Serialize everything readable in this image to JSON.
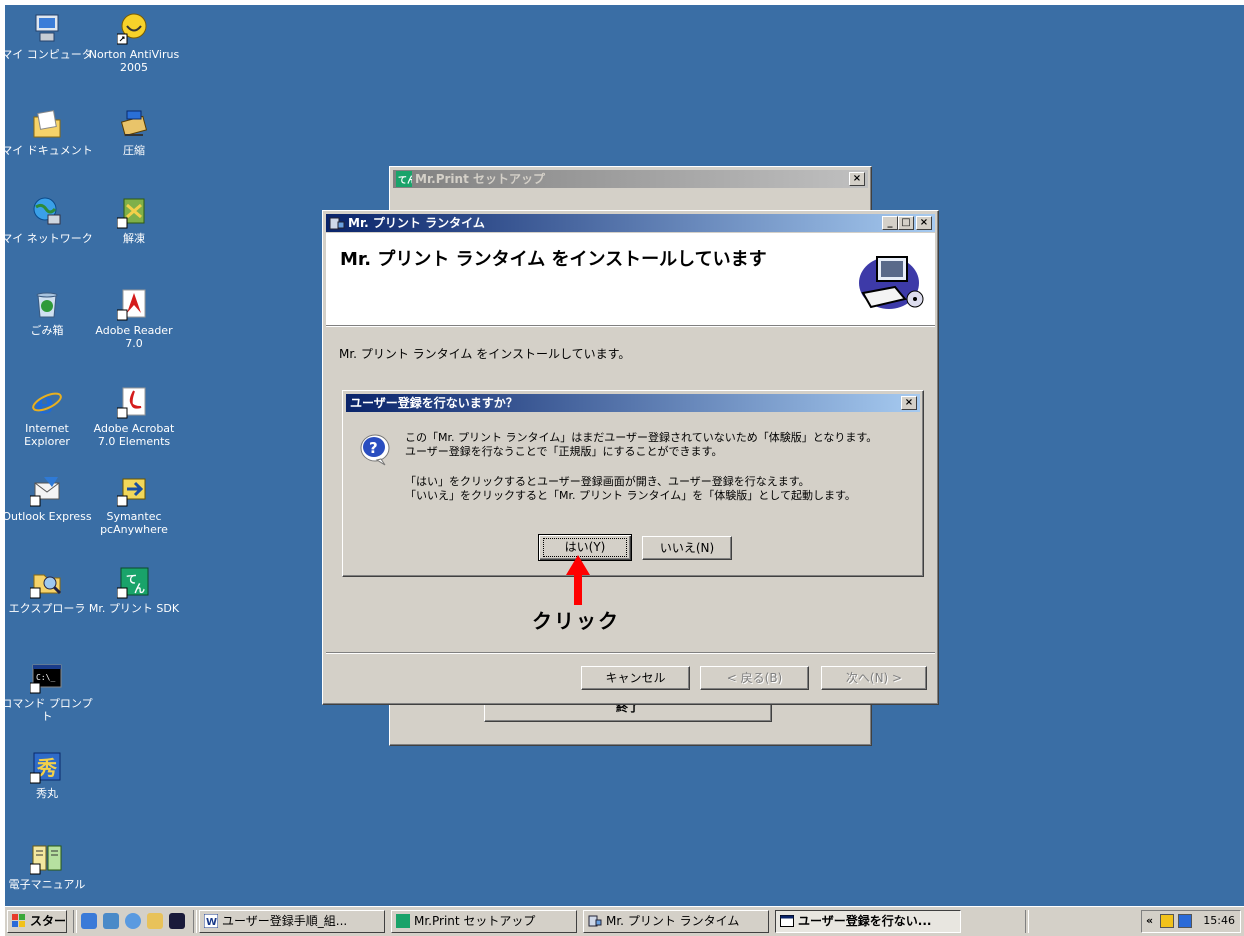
{
  "desktop": {
    "icons": [
      {
        "label": "マイ コンピュータ",
        "icon": "my-computer-icon"
      },
      {
        "label": "Norton AntiVirus 2005",
        "icon": "norton-antivirus-icon"
      },
      {
        "label": "マイ ドキュメント",
        "icon": "my-documents-icon"
      },
      {
        "label": "圧縮",
        "icon": "compress-icon"
      },
      {
        "label": "マイ ネットワーク",
        "icon": "my-network-icon"
      },
      {
        "label": "解凍",
        "icon": "extract-icon"
      },
      {
        "label": "ごみ箱",
        "icon": "recycle-bin-icon"
      },
      {
        "label": "Adobe Reader 7.0",
        "icon": "adobe-reader-icon"
      },
      {
        "label": "Internet Explorer",
        "icon": "internet-explorer-icon"
      },
      {
        "label": "Adobe Acrobat 7.0 Elements",
        "icon": "adobe-acrobat-icon"
      },
      {
        "label": "Outlook Express",
        "icon": "outlook-express-icon"
      },
      {
        "label": "Symantec pcAnywhere",
        "icon": "pcanywhere-icon"
      },
      {
        "label": "エクスプローラ",
        "icon": "explorer-icon"
      },
      {
        "label": "Mr. プリント SDK",
        "icon": "mr-print-sdk-icon"
      },
      {
        "label": "コマンド プロンプト",
        "icon": "command-prompt-icon"
      },
      {
        "label": "秀丸",
        "icon": "hidemaru-icon"
      },
      {
        "label": "電子マニュアル",
        "icon": "e-manual-icon"
      }
    ]
  },
  "setup_window": {
    "title": "Mr.Print セットアップ",
    "close": "×",
    "finish_button": "終了"
  },
  "runtime_window": {
    "title": "Mr. プリント ランタイム",
    "heading": "Mr. プリント ランタイム をインストールしています",
    "status": "Mr. プリント ランタイム をインストールしています。",
    "buttons": {
      "cancel": "キャンセル",
      "back": "< 戻る(B)",
      "next": "次へ(N) >"
    },
    "controls": {
      "minimize": "_",
      "maximize": "□",
      "close": "×"
    }
  },
  "dialog": {
    "title": "ユーザー登録を行ないますか？",
    "close": "×",
    "message_line1": "この「Mr. プリント ランタイム」はまだユーザー登録されていないため「体験版」となります。",
    "message_line2": "ユーザー登録を行なうことで「正規版」にすることができます。",
    "message_line3": "「はい」をクリックするとユーザー登録画面が開き、ユーザー登録を行なえます。",
    "message_line4": "「いいえ」をクリックすると「Mr. プリント ランタイム」を「体験版」として起動します。",
    "yes_button": "はい(Y)",
    "no_button": "いいえ(N)"
  },
  "annotation": {
    "label": "クリック",
    "color": "#ff0000"
  },
  "taskbar": {
    "start": "スタート",
    "items": [
      {
        "label": "ユーザー登録手順_組..."
      },
      {
        "label": "Mr.Print セットアップ"
      },
      {
        "label": "Mr. プリント ランタイム"
      },
      {
        "label": "ユーザー登録を行ない..."
      }
    ],
    "tray_expand": "«",
    "clock": "15:46"
  },
  "colors": {
    "desktop": "#3a6ea5",
    "active_title": "#0a246a",
    "face": "#d4d0c8"
  }
}
